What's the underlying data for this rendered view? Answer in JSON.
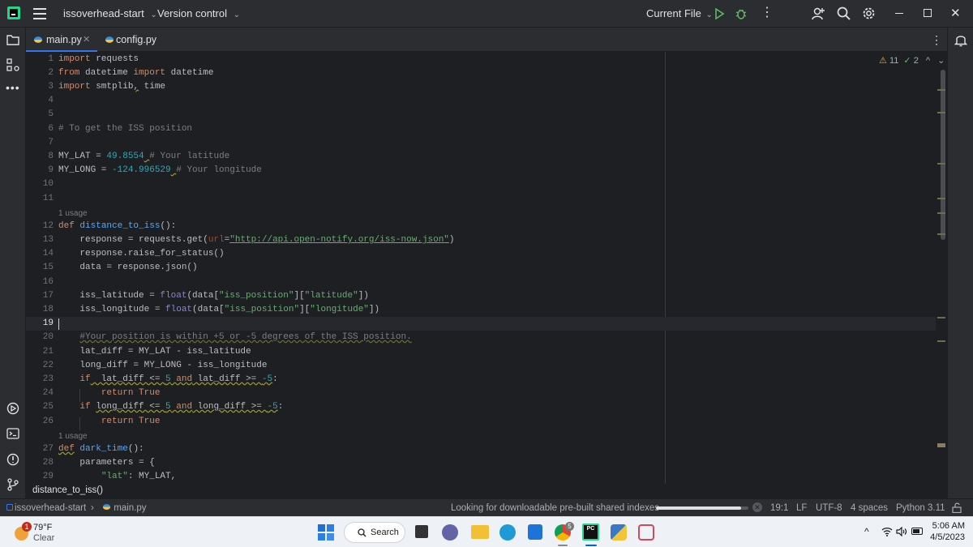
{
  "titlebar": {
    "project": "issoverhead-start",
    "vcs": "Version control",
    "run_config": "Current File"
  },
  "tabs": [
    {
      "label": "main.py",
      "active": true
    },
    {
      "label": "config.py",
      "active": false
    }
  ],
  "inspections": {
    "warnings": "11",
    "ok": "2"
  },
  "editor": {
    "usage_label": "1 usage",
    "current_line": "19"
  },
  "breadcrumb": "distance_to_iss()",
  "statusbar": {
    "project": "issoverhead-start",
    "file": "main.py",
    "task": "Looking for downloadable pre-built shared indexes",
    "task_progress": 0.92,
    "position": "19:1",
    "line_sep": "LF",
    "encoding": "UTF-8",
    "indent": "4 spaces",
    "interpreter": "Python 3.11"
  },
  "taskbar": {
    "weather_badge": "1",
    "temperature": "79°F",
    "condition": "Clear",
    "search_label": "Search",
    "chrome_badge": "5",
    "time": "5:06 AM",
    "date": "4/5/2023"
  },
  "colors": {
    "editor_bg": "#1e1f22",
    "chrome_bg": "#2b2d30",
    "keyword": "#cf8e6d",
    "string": "#6aab73",
    "number": "#2aacb8",
    "function": "#56a8f5",
    "comment": "#7a7e85",
    "run_green": "#5fb865",
    "warning_yellow": "#e8b230"
  }
}
